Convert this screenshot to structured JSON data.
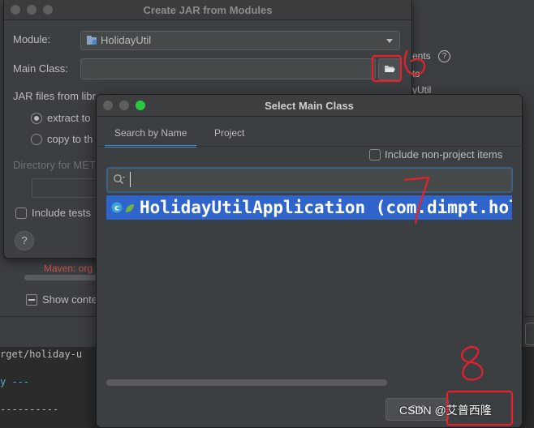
{
  "back_dialog": {
    "title": "Create JAR from Modules",
    "module_label": "Module:",
    "module_value": "HolidayUtil",
    "main_class_label": "Main Class:",
    "main_class_value": "",
    "jar_files_label": "JAR files from libr",
    "extract_label": "extract to",
    "copy_label": "copy to th",
    "directory_label": "Directory for MET",
    "include_tests_label": "Include tests",
    "help_label": "?"
  },
  "background": {
    "right_text_1": "ents",
    "right_text_2": "ts",
    "right_text_3": "yUtil",
    "maven_error": "Maven: org",
    "show_label": "Show conte",
    "terminal_lines": [
      "rget/holiday-u",
      "y ---",
      "----------"
    ]
  },
  "select_dialog": {
    "title": "Select Main Class",
    "tabs": [
      {
        "label": "Search by Name",
        "active": true
      },
      {
        "label": "Project",
        "active": false
      }
    ],
    "include_non_project_label": "Include non-project items",
    "search_value": "",
    "result": "HolidayUtilApplication (com.dimpt.holi",
    "ok_label": "OK"
  },
  "annotations": {
    "n6": "6",
    "n7": "7",
    "n8": "8"
  },
  "watermark": "CSDN @艾普西隆",
  "colors": {
    "selection": "#2f65ca",
    "accent_tab": "#4a88c7",
    "annotation_red": "#e8202a"
  }
}
